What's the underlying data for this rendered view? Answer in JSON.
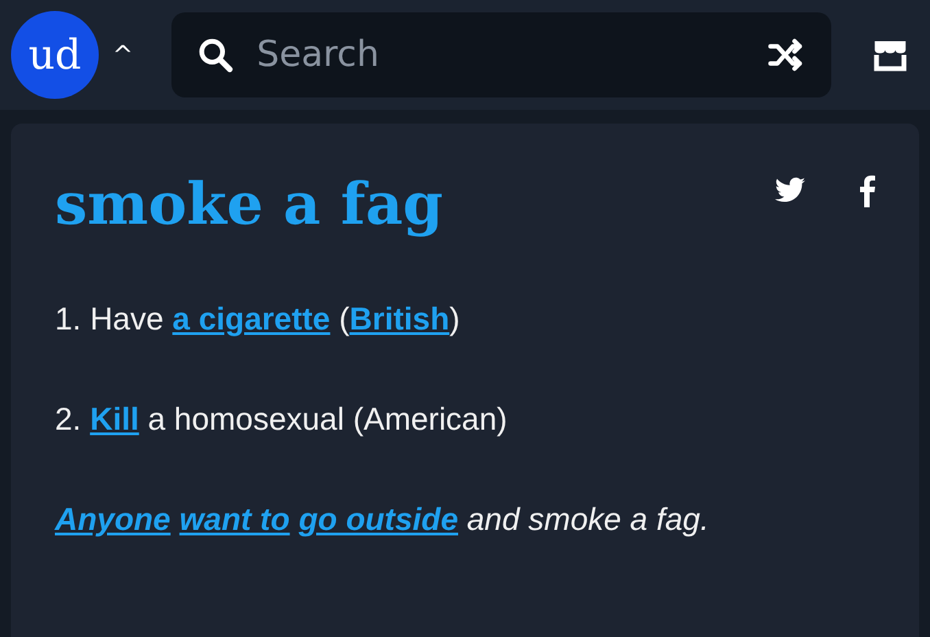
{
  "header": {
    "logo": "ud",
    "caret": "^",
    "search": {
      "placeholder": "Search"
    }
  },
  "entry": {
    "title": "smoke a fag",
    "definitions": [
      [
        {
          "kind": "plain",
          "text": "1. Have "
        },
        {
          "kind": "link",
          "text": "a cigarette"
        },
        {
          "kind": "plain",
          "text": " ("
        },
        {
          "kind": "link",
          "text": "British"
        },
        {
          "kind": "plain",
          "text": ")"
        }
      ],
      [
        {
          "kind": "plain",
          "text": "2. "
        },
        {
          "kind": "link",
          "text": "Kill"
        },
        {
          "kind": "plain",
          "text": " a homosexual (American)"
        }
      ]
    ],
    "example": [
      {
        "kind": "link",
        "text": "Anyone"
      },
      {
        "kind": "space"
      },
      {
        "kind": "link",
        "text": "want to"
      },
      {
        "kind": "space"
      },
      {
        "kind": "link",
        "text": "go outside"
      },
      {
        "kind": "plain",
        "text": " and smoke a fag."
      }
    ]
  }
}
